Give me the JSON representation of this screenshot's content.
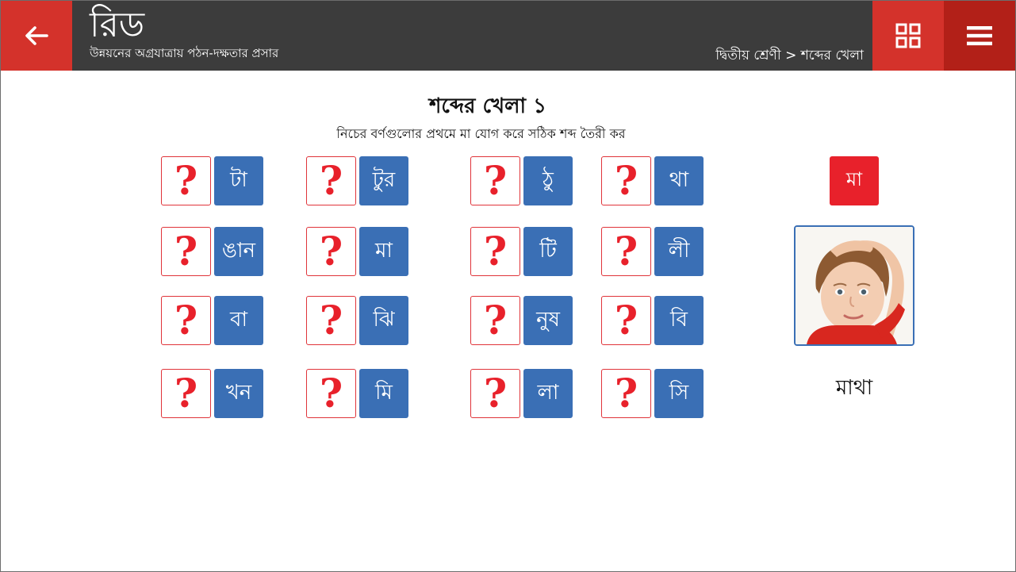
{
  "header": {
    "title": "রিড",
    "subtitle": "উন্নয়নের অগ্রযাত্রায় পঠন-দক্ষতার প্রসার",
    "breadcrumb": "দ্বিতীয় শ্রেণী > শব্দের খেলা",
    "back_icon": "arrow-left-icon",
    "grid_icon": "grid-icon",
    "menu_icon": "hamburger-menu-icon"
  },
  "game": {
    "title": "শব্দের খেলা ১",
    "instruction": "নিচের বর্ণগুলোর প্রথমে মা যোগ করে সঠিক শব্দ তৈরী কর",
    "placeholder": "?",
    "tiles": [
      [
        "টা",
        "টুর",
        "ঠু",
        "থা"
      ],
      [
        "ঙান",
        "মা",
        "টি",
        "লী"
      ],
      [
        "বা",
        "ঝি",
        "নুষ",
        "বি"
      ],
      [
        "খন",
        "মি",
        "লা",
        "সি"
      ]
    ],
    "prefix": "মা",
    "example_word": "মাথা"
  },
  "colors": {
    "header_bg": "#3c3c3c",
    "accent_red": "#d4322b",
    "dark_red": "#b22018",
    "tile_blue": "#3a6fb5",
    "question_red": "#e8212b"
  }
}
